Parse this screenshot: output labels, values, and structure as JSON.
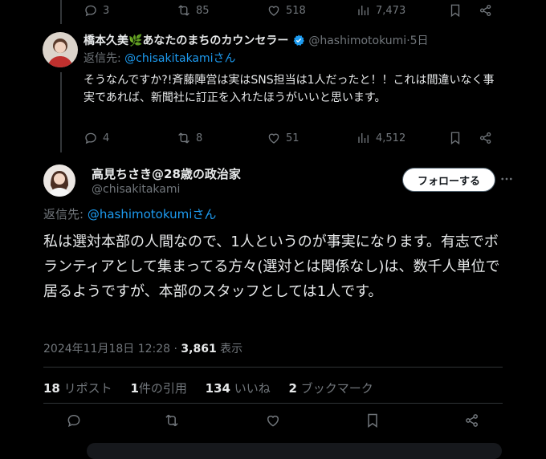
{
  "tweet_prev": {
    "actions": {
      "reply": "3",
      "retweet": "85",
      "like": "518",
      "views": "7,473"
    }
  },
  "tweet_reply": {
    "display_name": "橋本久美",
    "name_emoji": "🌿",
    "name_suffix": "あなたのまちのカウンセラー",
    "handle": "@hashimotokumi",
    "separator": "·",
    "time": "5日",
    "reply_to_prefix": "返信先: ",
    "reply_to_handle": "@chisakitakamiさん",
    "text": "そうなんですか?!斉藤陣営は実はSNS担当は1人だったと！！これは間違いなく事実であれば、新聞社に訂正を入れたほうがいいと思います。",
    "actions": {
      "reply": "4",
      "retweet": "8",
      "like": "51",
      "views": "4,512"
    }
  },
  "main_tweet": {
    "display_name": "高見ちさき@28歳の政治家",
    "handle": "@chisakitakami",
    "follow_label": "フォローする",
    "reply_to_prefix": "返信先: ",
    "reply_to_handle": "@hashimotokumiさん",
    "text": "私は選対本部の人間なので、1人というのが事実になります。有志でボランティアとして集まってる方々(選対とは関係なし)は、数千人単位で居るようですが、本部のスタッフとしては1人です。",
    "timestamp": "2024年11月18日 12:28",
    "dot": " · ",
    "views_count": "3,861",
    "views_label": " 表示",
    "stats": {
      "reposts_count": "18",
      "reposts_label": " リポスト",
      "quotes_count": "1",
      "quotes_label": "件の引用",
      "likes_count": "134",
      "likes_label": " いいね",
      "bookmarks_count": "2",
      "bookmarks_label": " ブックマーク"
    }
  },
  "colors": {
    "background": "#000000",
    "text": "#e7e9ea",
    "muted": "#71767b",
    "link": "#1d9bf0",
    "verified": "#1d9bf0"
  },
  "icons": [
    "reply-icon",
    "retweet-icon",
    "like-icon",
    "views-icon",
    "bookmark-icon",
    "share-icon",
    "verified-icon",
    "more-icon"
  ]
}
